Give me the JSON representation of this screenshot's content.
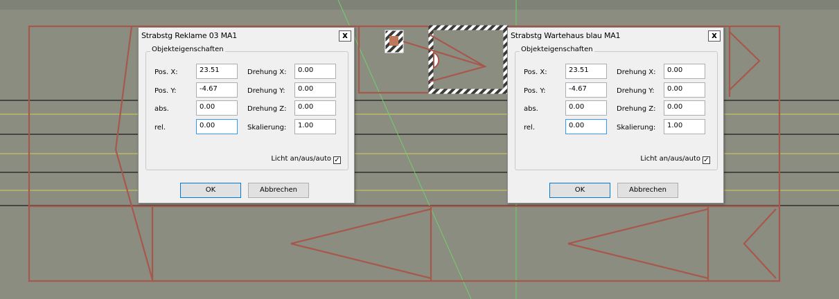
{
  "scene": {
    "background": "#8a8d80",
    "line_color": "#a8574c",
    "guide_green": "#6fd16a",
    "guide_yellow": "#d8d05a"
  },
  "dialogs": [
    {
      "title": "Strabstg Reklame 03 MA1",
      "close_label": "x",
      "group_label": "Objekteigenschaften",
      "pos_x_label": "Pos. X:",
      "pos_x": "23.51",
      "pos_y_label": "Pos. Y:",
      "pos_y": "-4.67",
      "abs_label": "abs.",
      "abs": "0.00",
      "rel_label": "rel.",
      "rel": "0.00",
      "rot_x_label": "Drehung X:",
      "rot_x": "0.00",
      "rot_y_label": "Drehung Y:",
      "rot_y": "0.00",
      "rot_z_label": "Drehung Z:",
      "rot_z": "0.00",
      "scale_label": "Skalierung:",
      "scale": "1.00",
      "light_label": "Licht an/aus/auto",
      "light_checked": "✓",
      "ok_label": "OK",
      "cancel_label": "Abbrechen"
    },
    {
      "title": "Strabstg Wartehaus blau MA1",
      "close_label": "x",
      "group_label": "Objekteigenschaften",
      "pos_x_label": "Pos. X:",
      "pos_x": "23.51",
      "pos_y_label": "Pos. Y:",
      "pos_y": "-4.67",
      "abs_label": "abs.",
      "abs": "0.00",
      "rel_label": "rel.",
      "rel": "0.00",
      "rot_x_label": "Drehung X:",
      "rot_x": "0.00",
      "rot_y_label": "Drehung Y:",
      "rot_y": "0.00",
      "rot_z_label": "Drehung Z:",
      "rot_z": "0.00",
      "scale_label": "Skalierung:",
      "scale": "1.00",
      "light_label": "Licht an/aus/auto",
      "light_checked": "✓",
      "ok_label": "OK",
      "cancel_label": "Abbrechen"
    }
  ]
}
